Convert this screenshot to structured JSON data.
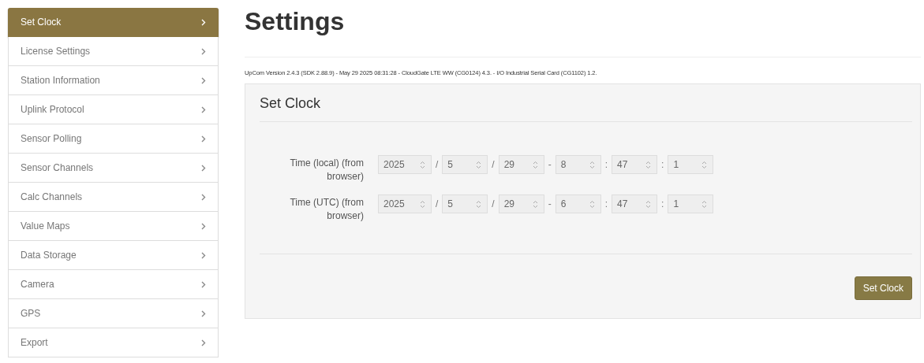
{
  "sidebar": {
    "items": [
      {
        "label": "Set Clock",
        "selected": true
      },
      {
        "label": "License Settings",
        "selected": false
      },
      {
        "label": "Station Information",
        "selected": false
      },
      {
        "label": "Uplink Protocol",
        "selected": false
      },
      {
        "label": "Sensor Polling",
        "selected": false
      },
      {
        "label": "Sensor Channels",
        "selected": false
      },
      {
        "label": "Calc Channels",
        "selected": false
      },
      {
        "label": "Value Maps",
        "selected": false
      },
      {
        "label": "Data Storage",
        "selected": false
      },
      {
        "label": "Camera",
        "selected": false
      },
      {
        "label": "GPS",
        "selected": false
      },
      {
        "label": "Export",
        "selected": false
      }
    ]
  },
  "page": {
    "title": "Settings",
    "version": "UpCom Version 2.4.3 (SDK 2.88.9) - May 29 2025 08:31:28 - CloudGate LTE WW (CG0124) 4.3. - I/O Industrial Serial Card (CG1102) 1.2."
  },
  "panel": {
    "title": "Set Clock",
    "rows": [
      {
        "label": "Time (local) (from browser)",
        "fields": [
          "2025",
          "5",
          "29",
          "8",
          "47",
          "1"
        ],
        "separators": [
          "/",
          "/",
          "-",
          ":",
          ":"
        ]
      },
      {
        "label": "Time (UTC) (from browser)",
        "fields": [
          "2025",
          "5",
          "29",
          "6",
          "47",
          "1"
        ],
        "separators": [
          "/",
          "/",
          "-",
          ":",
          ":"
        ]
      }
    ],
    "button": "Set Clock"
  }
}
